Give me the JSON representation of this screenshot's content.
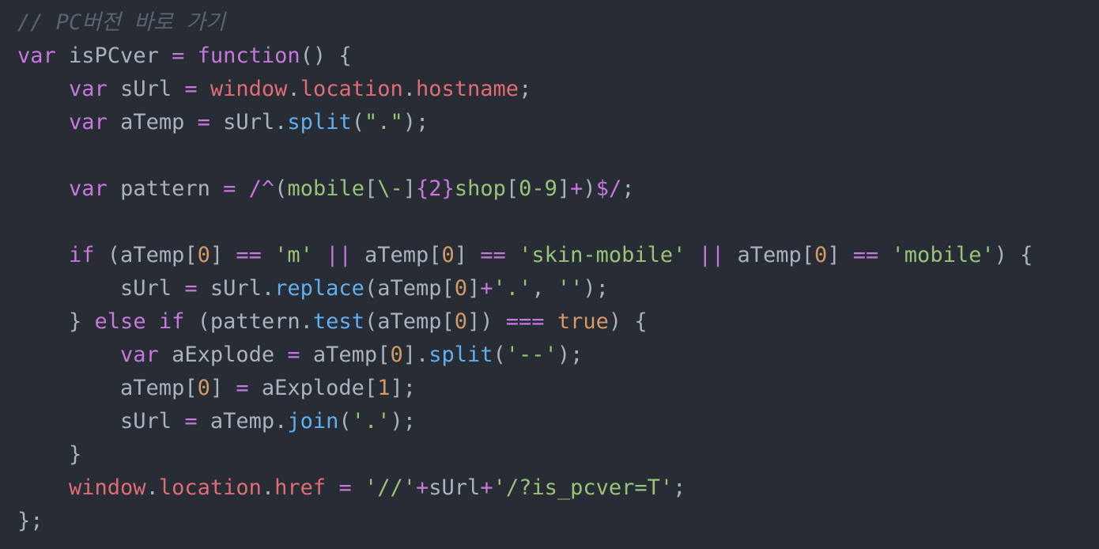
{
  "editor": {
    "background": "#282c34",
    "theme_colors": {
      "comment": "#5c6370",
      "keyword": "#c678dd",
      "function": "#61afef",
      "property": "#e06c75",
      "string": "#98c379",
      "number": "#d19a66",
      "plain": "#abb2bf"
    },
    "lines": [
      [
        {
          "t": "cmt",
          "v": "// PC버전 바로 가기"
        }
      ],
      [
        {
          "t": "kw",
          "v": "var"
        },
        {
          "t": "pl",
          "v": " isPCver "
        },
        {
          "t": "op",
          "v": "="
        },
        {
          "t": "pl",
          "v": " "
        },
        {
          "t": "kw",
          "v": "function"
        },
        {
          "t": "pl",
          "v": "() {"
        }
      ],
      [
        {
          "t": "pl",
          "v": "    "
        },
        {
          "t": "kw",
          "v": "var"
        },
        {
          "t": "pl",
          "v": " sUrl "
        },
        {
          "t": "op",
          "v": "="
        },
        {
          "t": "pl",
          "v": " "
        },
        {
          "t": "var",
          "v": "window"
        },
        {
          "t": "pl",
          "v": "."
        },
        {
          "t": "var",
          "v": "location"
        },
        {
          "t": "pl",
          "v": "."
        },
        {
          "t": "var",
          "v": "hostname"
        },
        {
          "t": "pl",
          "v": ";"
        }
      ],
      [
        {
          "t": "pl",
          "v": "    "
        },
        {
          "t": "kw",
          "v": "var"
        },
        {
          "t": "pl",
          "v": " aTemp "
        },
        {
          "t": "op",
          "v": "="
        },
        {
          "t": "pl",
          "v": " sUrl."
        },
        {
          "t": "fn",
          "v": "split"
        },
        {
          "t": "pl",
          "v": "("
        },
        {
          "t": "str",
          "v": "\".\""
        },
        {
          "t": "pl",
          "v": ");"
        }
      ],
      [
        {
          "t": "pl",
          "v": ""
        }
      ],
      [
        {
          "t": "pl",
          "v": "    "
        },
        {
          "t": "kw",
          "v": "var"
        },
        {
          "t": "pl",
          "v": " pattern "
        },
        {
          "t": "op",
          "v": "="
        },
        {
          "t": "pl",
          "v": " "
        },
        {
          "t": "rxd",
          "v": "/^"
        },
        {
          "t": "pl",
          "v": "("
        },
        {
          "t": "rx",
          "v": "mobile"
        },
        {
          "t": "pl",
          "v": "["
        },
        {
          "t": "rx",
          "v": "\\-"
        },
        {
          "t": "pl",
          "v": "]"
        },
        {
          "t": "rxd",
          "v": "{2}"
        },
        {
          "t": "rx",
          "v": "shop"
        },
        {
          "t": "pl",
          "v": "["
        },
        {
          "t": "rx",
          "v": "0-9"
        },
        {
          "t": "pl",
          "v": "]"
        },
        {
          "t": "rxd",
          "v": "+"
        },
        {
          "t": "pl",
          "v": ")"
        },
        {
          "t": "rxd",
          "v": "$/"
        },
        {
          "t": "pl",
          "v": ";"
        }
      ],
      [
        {
          "t": "pl",
          "v": ""
        }
      ],
      [
        {
          "t": "pl",
          "v": "    "
        },
        {
          "t": "kw",
          "v": "if"
        },
        {
          "t": "pl",
          "v": " (aTemp["
        },
        {
          "t": "num",
          "v": "0"
        },
        {
          "t": "pl",
          "v": "] "
        },
        {
          "t": "op",
          "v": "=="
        },
        {
          "t": "pl",
          "v": " "
        },
        {
          "t": "str",
          "v": "'m'"
        },
        {
          "t": "pl",
          "v": " "
        },
        {
          "t": "op",
          "v": "||"
        },
        {
          "t": "pl",
          "v": " aTemp["
        },
        {
          "t": "num",
          "v": "0"
        },
        {
          "t": "pl",
          "v": "] "
        },
        {
          "t": "op",
          "v": "=="
        },
        {
          "t": "pl",
          "v": " "
        },
        {
          "t": "str",
          "v": "'skin-mobile'"
        },
        {
          "t": "pl",
          "v": " "
        },
        {
          "t": "op",
          "v": "||"
        },
        {
          "t": "pl",
          "v": " aTemp["
        },
        {
          "t": "num",
          "v": "0"
        },
        {
          "t": "pl",
          "v": "] "
        },
        {
          "t": "op",
          "v": "=="
        },
        {
          "t": "pl",
          "v": " "
        },
        {
          "t": "str",
          "v": "'mobile'"
        },
        {
          "t": "pl",
          "v": ") {"
        }
      ],
      [
        {
          "t": "pl",
          "v": "        sUrl "
        },
        {
          "t": "op",
          "v": "="
        },
        {
          "t": "pl",
          "v": " sUrl."
        },
        {
          "t": "fn",
          "v": "replace"
        },
        {
          "t": "pl",
          "v": "(aTemp["
        },
        {
          "t": "num",
          "v": "0"
        },
        {
          "t": "pl",
          "v": "]"
        },
        {
          "t": "op",
          "v": "+"
        },
        {
          "t": "str",
          "v": "'.'"
        },
        {
          "t": "pl",
          "v": ", "
        },
        {
          "t": "str",
          "v": "''"
        },
        {
          "t": "pl",
          "v": ");"
        }
      ],
      [
        {
          "t": "pl",
          "v": "    } "
        },
        {
          "t": "kw",
          "v": "else"
        },
        {
          "t": "pl",
          "v": " "
        },
        {
          "t": "kw",
          "v": "if"
        },
        {
          "t": "pl",
          "v": " (pattern."
        },
        {
          "t": "fn",
          "v": "test"
        },
        {
          "t": "pl",
          "v": "(aTemp["
        },
        {
          "t": "num",
          "v": "0"
        },
        {
          "t": "pl",
          "v": "]) "
        },
        {
          "t": "op",
          "v": "==="
        },
        {
          "t": "pl",
          "v": " "
        },
        {
          "t": "num",
          "v": "true"
        },
        {
          "t": "pl",
          "v": ") {"
        }
      ],
      [
        {
          "t": "pl",
          "v": "        "
        },
        {
          "t": "kw",
          "v": "var"
        },
        {
          "t": "pl",
          "v": " aExplode "
        },
        {
          "t": "op",
          "v": "="
        },
        {
          "t": "pl",
          "v": " aTemp["
        },
        {
          "t": "num",
          "v": "0"
        },
        {
          "t": "pl",
          "v": "]."
        },
        {
          "t": "fn",
          "v": "split"
        },
        {
          "t": "pl",
          "v": "("
        },
        {
          "t": "str",
          "v": "'--'"
        },
        {
          "t": "pl",
          "v": ");"
        }
      ],
      [
        {
          "t": "pl",
          "v": "        aTemp["
        },
        {
          "t": "num",
          "v": "0"
        },
        {
          "t": "pl",
          "v": "] "
        },
        {
          "t": "op",
          "v": "="
        },
        {
          "t": "pl",
          "v": " aExplode["
        },
        {
          "t": "num",
          "v": "1"
        },
        {
          "t": "pl",
          "v": "];"
        }
      ],
      [
        {
          "t": "pl",
          "v": "        sUrl "
        },
        {
          "t": "op",
          "v": "="
        },
        {
          "t": "pl",
          "v": " aTemp."
        },
        {
          "t": "fn",
          "v": "join"
        },
        {
          "t": "pl",
          "v": "("
        },
        {
          "t": "str",
          "v": "'.'"
        },
        {
          "t": "pl",
          "v": ");"
        }
      ],
      [
        {
          "t": "pl",
          "v": "    }"
        }
      ],
      [
        {
          "t": "pl",
          "v": "    "
        },
        {
          "t": "var",
          "v": "window"
        },
        {
          "t": "pl",
          "v": "."
        },
        {
          "t": "var",
          "v": "location"
        },
        {
          "t": "pl",
          "v": "."
        },
        {
          "t": "var",
          "v": "href"
        },
        {
          "t": "pl",
          "v": " "
        },
        {
          "t": "op",
          "v": "="
        },
        {
          "t": "pl",
          "v": " "
        },
        {
          "t": "str",
          "v": "'//'"
        },
        {
          "t": "op",
          "v": "+"
        },
        {
          "t": "pl",
          "v": "sUrl"
        },
        {
          "t": "op",
          "v": "+"
        },
        {
          "t": "str",
          "v": "'/?is_pcver=T'"
        },
        {
          "t": "pl",
          "v": ";"
        }
      ],
      [
        {
          "t": "pl",
          "v": "};"
        }
      ]
    ]
  }
}
